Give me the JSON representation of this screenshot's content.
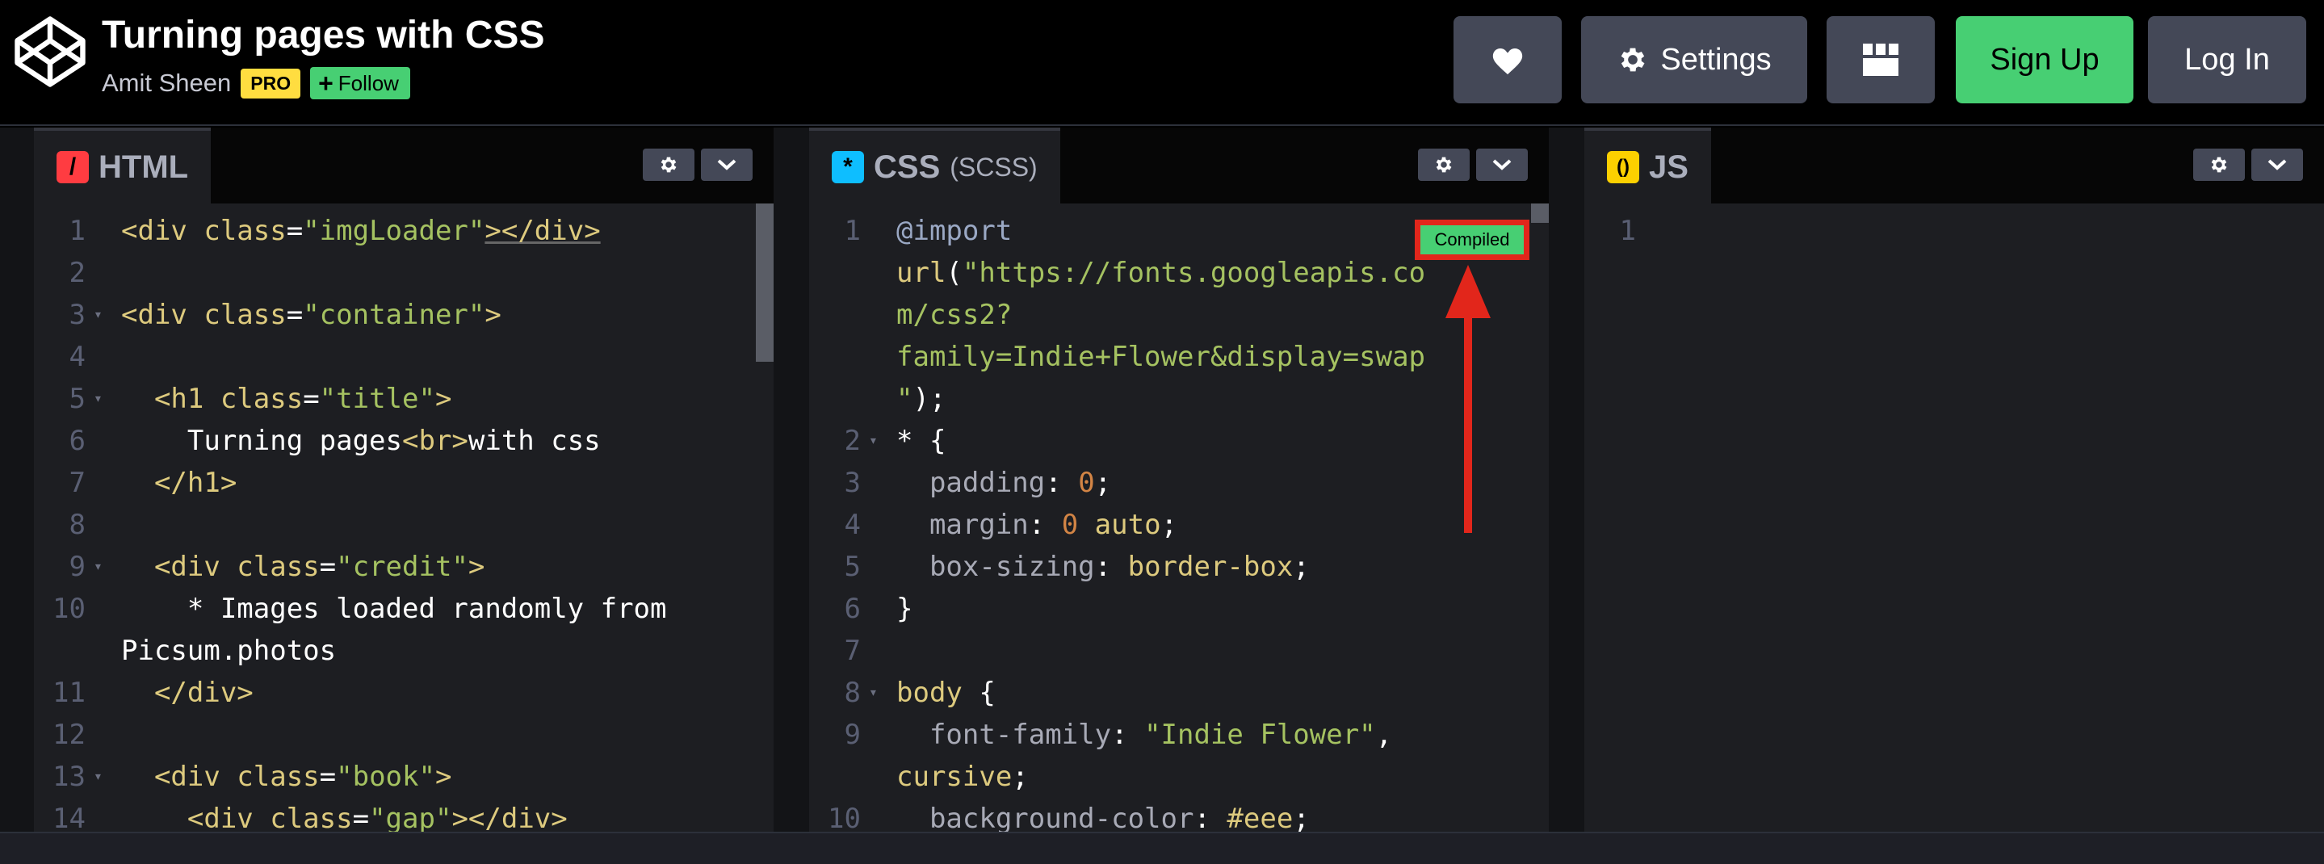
{
  "header": {
    "title": "Turning pages with CSS",
    "author": "Amit Sheen",
    "pro_badge": "PRO",
    "follow_label": "Follow",
    "settings_label": "Settings",
    "signup_label": "Sign Up",
    "login_label": "Log In"
  },
  "panes": {
    "html": {
      "name": "HTML",
      "icon_char": "/"
    },
    "css": {
      "name": "CSS",
      "sub": "(SCSS)",
      "icon_char": "*"
    },
    "js": {
      "name": "JS",
      "icon_char": "()"
    }
  },
  "compiled_badge": "Compiled",
  "html_code": [
    {
      "n": "1",
      "fold": false,
      "tokens": [
        [
          "t-tag",
          "<div "
        ],
        [
          "t-attr",
          "class"
        ],
        [
          "t-punc",
          "="
        ],
        [
          "t-str",
          "\"imgLoader\""
        ],
        [
          "t-tag",
          "></div>"
        ]
      ]
    },
    {
      "n": "2",
      "fold": false,
      "tokens": []
    },
    {
      "n": "3",
      "fold": true,
      "tokens": [
        [
          "t-tag",
          "<div "
        ],
        [
          "t-attr",
          "class"
        ],
        [
          "t-punc",
          "="
        ],
        [
          "t-str",
          "\"container\""
        ],
        [
          "t-tag",
          ">"
        ]
      ]
    },
    {
      "n": "4",
      "fold": false,
      "tokens": []
    },
    {
      "n": "5",
      "fold": true,
      "tokens": [
        [
          "t-tag",
          "  <h1 "
        ],
        [
          "t-attr",
          "class"
        ],
        [
          "t-punc",
          "="
        ],
        [
          "t-str",
          "\"title\""
        ],
        [
          "t-tag",
          ">"
        ]
      ]
    },
    {
      "n": "6",
      "fold": false,
      "tokens": [
        [
          "t-text",
          "    Turning pages"
        ],
        [
          "t-tag",
          "<br>"
        ],
        [
          "t-text",
          "with css"
        ]
      ]
    },
    {
      "n": "7",
      "fold": false,
      "tokens": [
        [
          "t-tag",
          "  </h1>"
        ]
      ]
    },
    {
      "n": "8",
      "fold": false,
      "tokens": []
    },
    {
      "n": "9",
      "fold": true,
      "tokens": [
        [
          "t-tag",
          "  <div "
        ],
        [
          "t-attr",
          "class"
        ],
        [
          "t-punc",
          "="
        ],
        [
          "t-str",
          "\"credit\""
        ],
        [
          "t-tag",
          ">"
        ]
      ]
    },
    {
      "n": "10",
      "fold": false,
      "tokens": [
        [
          "t-text",
          "    * Images loaded randomly from"
        ]
      ]
    },
    {
      "n": "",
      "fold": false,
      "tokens": [
        [
          "t-text",
          "Picsum.photos"
        ]
      ]
    },
    {
      "n": "11",
      "fold": false,
      "tokens": [
        [
          "t-tag",
          "  </div>"
        ]
      ]
    },
    {
      "n": "12",
      "fold": false,
      "tokens": []
    },
    {
      "n": "13",
      "fold": true,
      "tokens": [
        [
          "t-tag",
          "  <div "
        ],
        [
          "t-attr",
          "class"
        ],
        [
          "t-punc",
          "="
        ],
        [
          "t-str",
          "\"book\""
        ],
        [
          "t-tag",
          ">"
        ]
      ]
    },
    {
      "n": "14",
      "fold": false,
      "tokens": [
        [
          "t-tag",
          "    <div "
        ],
        [
          "t-attr",
          "class"
        ],
        [
          "t-punc",
          "="
        ],
        [
          "t-str",
          "\"gap\""
        ],
        [
          "t-tag",
          "></div>"
        ]
      ]
    }
  ],
  "css_code": [
    {
      "n": "1",
      "fold": false,
      "tokens": [
        [
          "t-at",
          "@import"
        ]
      ]
    },
    {
      "n": "",
      "fold": false,
      "tokens": [
        [
          "t-val",
          "url"
        ],
        [
          "t-punc",
          "("
        ],
        [
          "t-str",
          "\"https://fonts.googleapis.co"
        ]
      ]
    },
    {
      "n": "",
      "fold": false,
      "tokens": [
        [
          "t-str",
          "m/css2?"
        ]
      ]
    },
    {
      "n": "",
      "fold": false,
      "tokens": [
        [
          "t-str",
          "family=Indie+Flower&display=swap"
        ]
      ]
    },
    {
      "n": "",
      "fold": false,
      "tokens": [
        [
          "t-str",
          "\""
        ],
        [
          "t-punc",
          ");"
        ]
      ]
    },
    {
      "n": "2",
      "fold": true,
      "tokens": [
        [
          "t-punc",
          "* {"
        ]
      ]
    },
    {
      "n": "3",
      "fold": false,
      "tokens": [
        [
          "t-prop",
          "  padding"
        ],
        [
          "t-punc",
          ": "
        ],
        [
          "t-num",
          "0"
        ],
        [
          "t-punc",
          ";"
        ]
      ]
    },
    {
      "n": "4",
      "fold": false,
      "tokens": [
        [
          "t-prop",
          "  margin"
        ],
        [
          "t-punc",
          ": "
        ],
        [
          "t-num",
          "0"
        ],
        [
          "t-val",
          " auto"
        ],
        [
          "t-punc",
          ";"
        ]
      ]
    },
    {
      "n": "5",
      "fold": false,
      "tokens": [
        [
          "t-prop",
          "  box-sizing"
        ],
        [
          "t-punc",
          ": "
        ],
        [
          "t-val",
          "border-box"
        ],
        [
          "t-punc",
          ";"
        ]
      ]
    },
    {
      "n": "6",
      "fold": false,
      "tokens": [
        [
          "t-punc",
          "}"
        ]
      ]
    },
    {
      "n": "7",
      "fold": false,
      "tokens": []
    },
    {
      "n": "8",
      "fold": true,
      "tokens": [
        [
          "t-val",
          "body"
        ],
        [
          "t-punc",
          " {"
        ]
      ]
    },
    {
      "n": "9",
      "fold": false,
      "tokens": [
        [
          "t-prop",
          "  font-family"
        ],
        [
          "t-punc",
          ": "
        ],
        [
          "t-str",
          "\"Indie Flower\""
        ],
        [
          "t-punc",
          ","
        ]
      ]
    },
    {
      "n": "",
      "fold": false,
      "tokens": [
        [
          "t-val",
          "cursive"
        ],
        [
          "t-punc",
          ";"
        ]
      ]
    },
    {
      "n": "10",
      "fold": false,
      "tokens": [
        [
          "t-prop",
          "  background-color"
        ],
        [
          "t-punc",
          ": "
        ],
        [
          "t-val",
          "#eee"
        ],
        [
          "t-punc",
          ";"
        ]
      ]
    }
  ],
  "js_code": [
    {
      "n": "1",
      "fold": false,
      "tokens": []
    }
  ],
  "colors": {
    "html_icon": "#ff3c41",
    "css_icon": "#0ebeff",
    "js_icon": "#fcd000",
    "signup": "#47cf73",
    "highlight": "#e2261b"
  }
}
